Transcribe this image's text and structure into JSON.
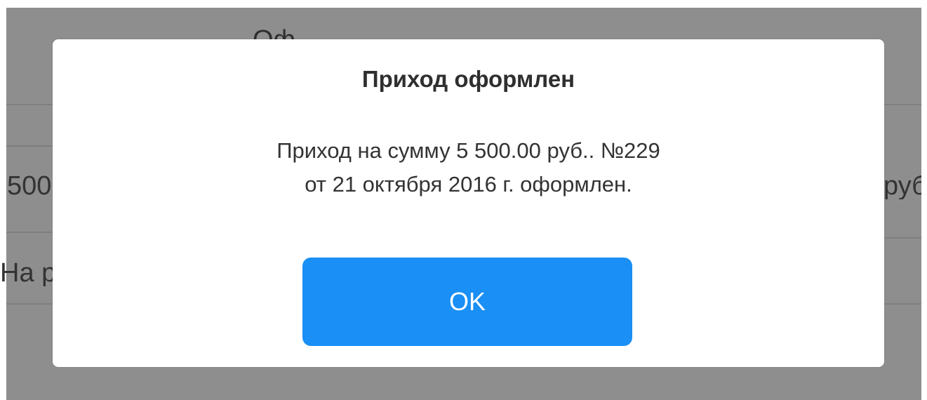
{
  "dialog": {
    "title": "Приход оформлен",
    "message_line1": "Приход на сумму 5 500.00 руб.. №229",
    "message_line2": "от 21 октября 2016 г. оформлен.",
    "ok_label": "OK",
    "button_color": "#1a8ff5"
  },
  "background": {
    "header_text": "Оф",
    "amount_left": "500",
    "amount_right": "руб",
    "label_left": "На р",
    "overlay_color": "#8e8e8e"
  }
}
